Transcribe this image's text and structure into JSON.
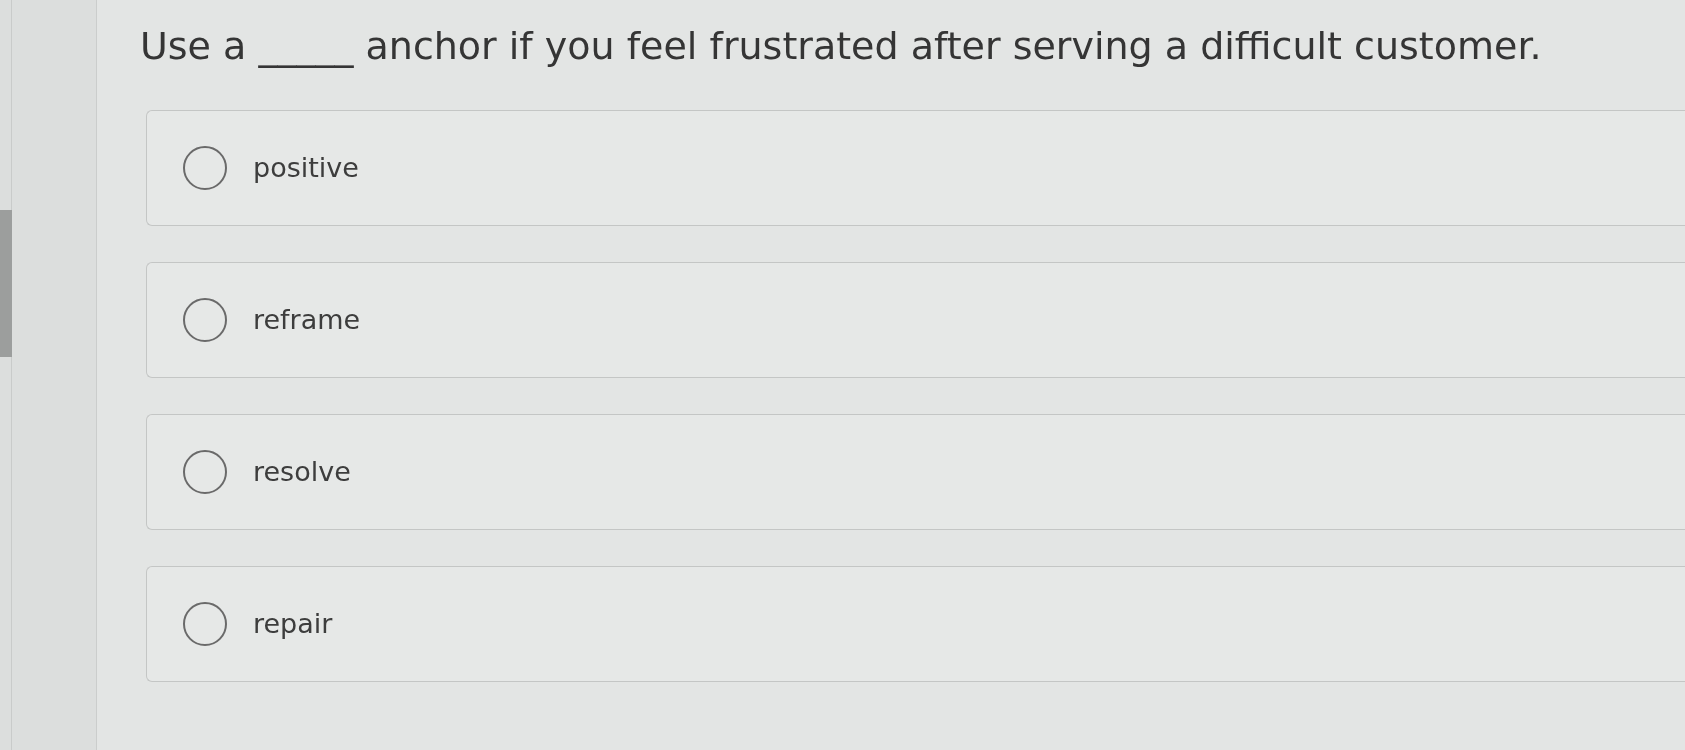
{
  "question": {
    "text": "Use a _____ anchor if you feel frustrated after serving a difficult customer."
  },
  "options": [
    {
      "label": "positive",
      "selected": false
    },
    {
      "label": "reframe",
      "selected": false
    },
    {
      "label": "resolve",
      "selected": false
    },
    {
      "label": "repair",
      "selected": false
    }
  ]
}
